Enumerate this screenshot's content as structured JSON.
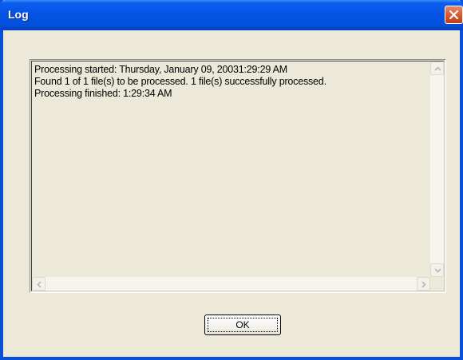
{
  "window": {
    "title": "Log"
  },
  "log": {
    "lines": [
      "Processing started: Thursday, January 09, 20031:29:29 AM",
      "Found 1 of 1 file(s) to be processed. 1 file(s) successfully processed.",
      "Processing finished: 1:29:34 AM"
    ]
  },
  "buttons": {
    "ok_label": "OK"
  },
  "icons": {
    "close": "close-icon",
    "scroll_up": "arrow-up-icon",
    "scroll_down": "arrow-down-icon",
    "scroll_left": "arrow-left-icon",
    "scroll_right": "arrow-right-icon"
  },
  "colors": {
    "titlebar": "#0553e4",
    "face": "#ece9d8",
    "close_button": "#d95a2e"
  }
}
